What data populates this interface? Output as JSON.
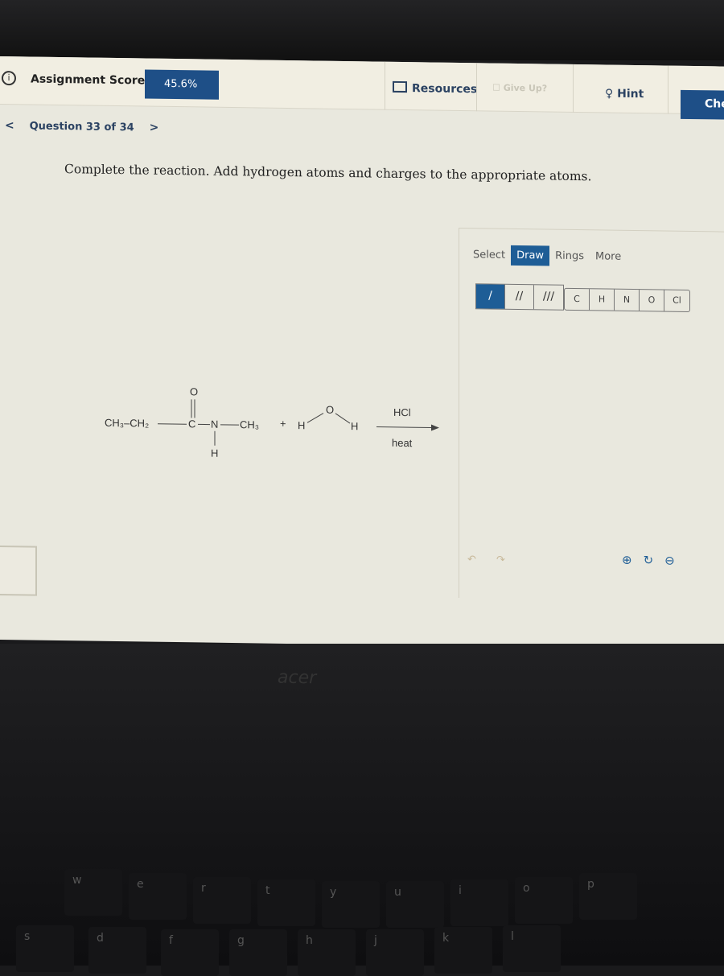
{
  "header": {
    "score_label": "Assignment Score:",
    "score_value": "45.6%",
    "resources": "Resources",
    "give_up": "Give Up?",
    "hint": "Hint",
    "check": "Che"
  },
  "nav": {
    "prev": "<",
    "question": "Question 33 of 34",
    "next": ">"
  },
  "prompt": "Complete the reaction. Add hydrogen atoms and charges to the appropriate atoms.",
  "editor": {
    "tabs": [
      {
        "label": "Select"
      },
      {
        "label": "Draw",
        "active": true
      },
      {
        "label": "Rings"
      },
      {
        "label": "More"
      }
    ],
    "bonds": [
      "/",
      "//",
      "///"
    ],
    "atoms": [
      "C",
      "H",
      "N",
      "O",
      "Cl"
    ],
    "undo": "↶",
    "redo": "↷",
    "zoom_in": "⊕",
    "reset": "↻",
    "zoom_out": "⊖"
  },
  "reaction": {
    "reactant1": "CH3–CH2–C(=O)–N(H)–CH3",
    "o": "O",
    "ch3ch2": "CH₃–CH₂",
    "c": "C",
    "n": "N",
    "ch3": "CH₃",
    "h": "H",
    "plus": "+",
    "water_h1": "H",
    "water_o": "O",
    "water_h2": "H",
    "reagent": "HCl",
    "condition": "heat"
  },
  "keyboard": {
    "brand": "acer",
    "keys": [
      "w",
      "e",
      "r",
      "t",
      "y",
      "u",
      "i",
      "o",
      "p",
      "s",
      "d",
      "f",
      "g",
      "h",
      "j",
      "k",
      "l"
    ]
  },
  "colors": {
    "brand": "#1e4f87",
    "active_tab": "#1e5d96"
  }
}
